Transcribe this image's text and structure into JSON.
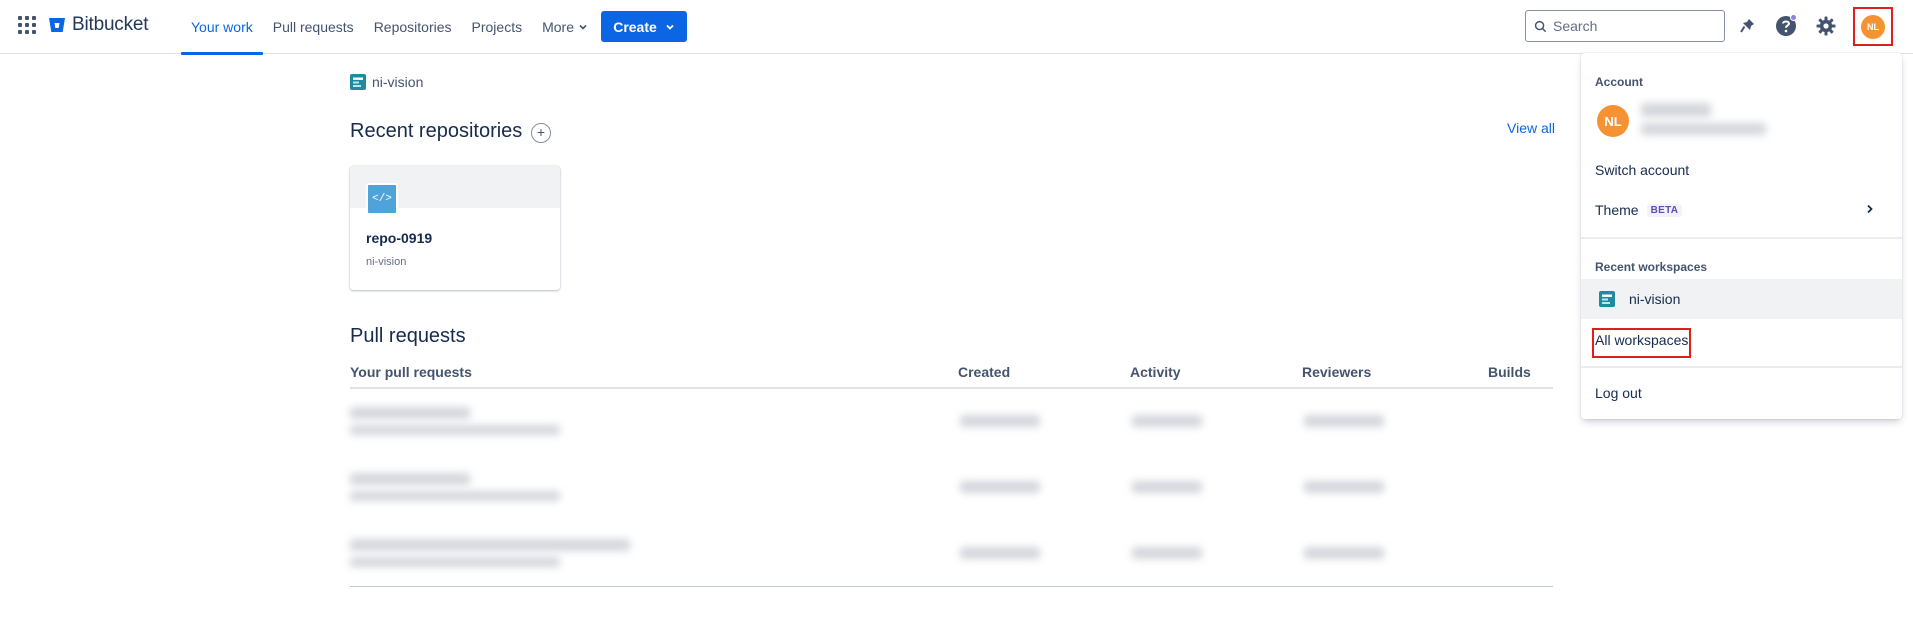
{
  "topnav": {
    "brand": "Bitbucket",
    "items": [
      {
        "label": "Your work",
        "active": true
      },
      {
        "label": "Pull requests",
        "active": false
      },
      {
        "label": "Repositories",
        "active": false
      },
      {
        "label": "Projects",
        "active": false
      },
      {
        "label": "More",
        "active": false
      }
    ],
    "create_label": "Create",
    "search_placeholder": "Search",
    "profile_initials": "NL",
    "brand_color": "#0c66e4"
  },
  "main": {
    "workspace_name": "ni-vision",
    "recent_repos_title": "Recent repositories",
    "view_all_label": "View all",
    "repo_card": {
      "name": "repo-0919",
      "workspace": "ni-vision"
    },
    "pull_requests_title": "Pull requests",
    "pr_columns": [
      "Your pull requests",
      "Created",
      "Activity",
      "Reviewers",
      "Builds"
    ]
  },
  "dropdown": {
    "account_heading": "Account",
    "avatar_initials": "NL",
    "switch_account": "Switch account",
    "theme_label": "Theme",
    "theme_badge": "BETA",
    "recent_workspaces_heading": "Recent workspaces",
    "workspace_item": "ni-vision",
    "all_workspaces": "All workspaces",
    "log_out": "Log out"
  }
}
